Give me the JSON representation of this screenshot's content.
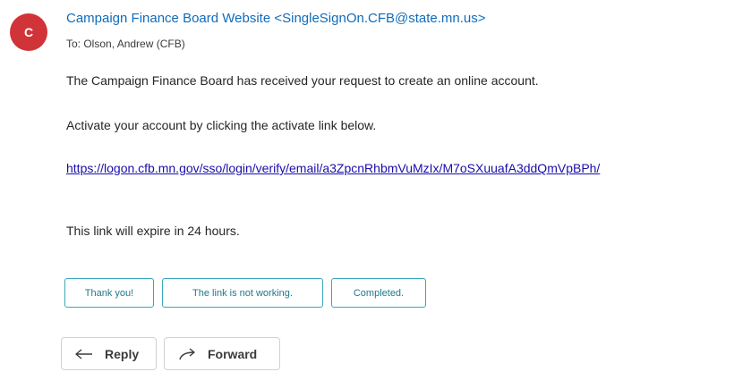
{
  "sender": {
    "avatar_initial": "C",
    "name": "Campaign Finance Board Website <SingleSignOn.CFB@state.mn.us>",
    "to": "To:  Olson, Andrew (CFB)"
  },
  "message": {
    "paragraph_1": "The Campaign Finance Board has received your request to create an online account.",
    "paragraph_2": "Activate your account by clicking the activate link below.",
    "link": "https://logon.cfb.mn.gov/sso/login/verify/email/a3ZpcnRhbmVuMzIx/M7oSXuuafA3ddQmVpBPh/",
    "paragraph_3": "This link will expire in 24 hours."
  },
  "quick_replies": [
    "Thank you!",
    "The link is not working.",
    "Completed."
  ],
  "actions": {
    "reply_label": "Reply",
    "forward_label": "Forward"
  },
  "colors": {
    "avatar": "#d13438",
    "sender": "#0f6cbd",
    "link": "#1a0dab",
    "chip_border": "#3aa6b9"
  }
}
